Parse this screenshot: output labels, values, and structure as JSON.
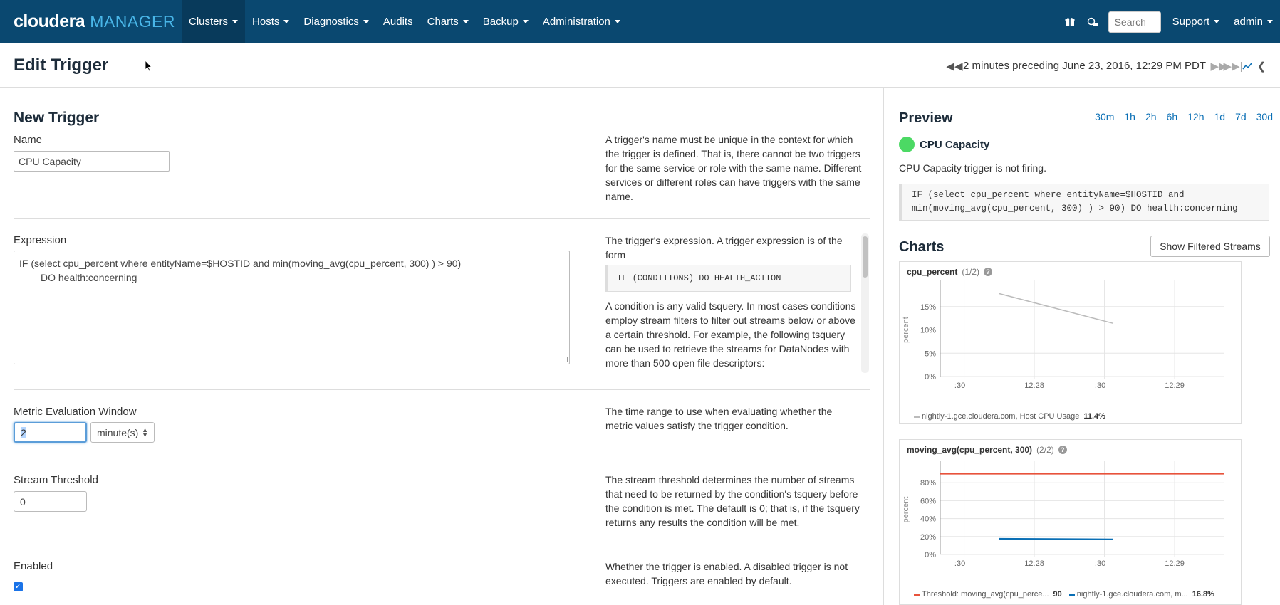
{
  "navbar": {
    "brand_main": "cloudera",
    "brand_sub": "MANAGER",
    "items": [
      {
        "label": "Clusters",
        "dropdown": true
      },
      {
        "label": "Hosts",
        "dropdown": true
      },
      {
        "label": "Diagnostics",
        "dropdown": true
      },
      {
        "label": "Audits",
        "dropdown": false
      },
      {
        "label": "Charts",
        "dropdown": true
      },
      {
        "label": "Backup",
        "dropdown": true
      },
      {
        "label": "Administration",
        "dropdown": true
      }
    ],
    "search_placeholder": "Search",
    "support_label": "Support",
    "user_label": "admin"
  },
  "header": {
    "title": "Edit Trigger",
    "time_range": "2 minutes preceding June 23, 2016, 12:29 PM PDT"
  },
  "form": {
    "section_title": "New Trigger",
    "name": {
      "label": "Name",
      "value": "CPU Capacity",
      "help": "A trigger's name must be unique in the context for which the trigger is defined. That is, there cannot be two triggers for the same service or role with the same name. Different services or different roles can have triggers with the same name."
    },
    "expression": {
      "label": "Expression",
      "line1": "IF (select cpu_percent where entityName=$HOSTID and min(moving_avg(cpu_percent, 300) ) > 90)",
      "line2": "DO health:concerning",
      "help_intro": "The trigger's expression. A trigger expression is of the form",
      "help_code": "IF (CONDITIONS) DO HEALTH_ACTION",
      "help_more": "A condition is any valid tsquery. In most cases conditions employ stream filters to filter out streams below or above a certain threshold. For example, the following tsquery can be used to retrieve the streams for DataNodes with more than 500 open file descriptors:"
    },
    "window": {
      "label": "Metric Evaluation Window",
      "value": "2",
      "unit": "minute(s)",
      "help": "The time range to use when evaluating whether the metric values satisfy the trigger condition."
    },
    "threshold": {
      "label": "Stream Threshold",
      "value": "0",
      "help": "The stream threshold determines the number of streams that need to be returned by the condition's tsquery before the condition is met. The default is 0; that is, if the tsquery returns any results the condition will be met."
    },
    "enabled": {
      "label": "Enabled",
      "checked": true,
      "help": "Whether the trigger is enabled. A disabled trigger is not executed. Triggers are enabled by default."
    }
  },
  "preview": {
    "title": "Preview",
    "ranges": [
      "30m",
      "1h",
      "2h",
      "6h",
      "12h",
      "1d",
      "7d",
      "30d"
    ],
    "trigger_name": "CPU Capacity",
    "status_text": "CPU Capacity trigger is not firing.",
    "status_color": "#4cd964",
    "expr_line1": "IF (select cpu_percent where entityName=$HOSTID and",
    "expr_line2": "min(moving_avg(cpu_percent, 300) ) > 90) DO health:concerning",
    "charts_title": "Charts",
    "show_streams_label": "Show Filtered Streams"
  },
  "chart_data": [
    {
      "type": "line",
      "title": "cpu_percent",
      "count": "(1/2)",
      "ylabel": "percent",
      "yticks": [
        "0%",
        "5%",
        "10%",
        "15%"
      ],
      "ylim": [
        0,
        20
      ],
      "xticks": [
        ":30",
        "12:28",
        ":30",
        "12:29"
      ],
      "x": [
        0.4,
        1.4
      ],
      "series": [
        {
          "name": "nightly-1.gce.cloudera.com, Host CPU Usage",
          "color": "#bbbbbb",
          "y": [
            17.8,
            11.4
          ],
          "legend_value": "11.4%"
        }
      ]
    },
    {
      "type": "line",
      "title": "moving_avg(cpu_percent, 300)",
      "count": "(2/2)",
      "ylabel": "percent",
      "yticks": [
        "0%",
        "20%",
        "40%",
        "60%",
        "80%"
      ],
      "ylim": [
        0,
        100
      ],
      "xticks": [
        ":30",
        "12:28",
        ":30",
        "12:29"
      ],
      "x": [
        0.4,
        1.4
      ],
      "series": [
        {
          "name": "Threshold: moving_avg(cpu_perce...",
          "color": "#e8533c",
          "y": [
            90,
            90
          ],
          "full_width": true,
          "legend_value": "90"
        },
        {
          "name": "nightly-1.gce.cloudera.com, m...",
          "color": "#0a6fb5",
          "y": [
            17.5,
            16.8
          ],
          "legend_value": "16.8%"
        }
      ]
    }
  ]
}
